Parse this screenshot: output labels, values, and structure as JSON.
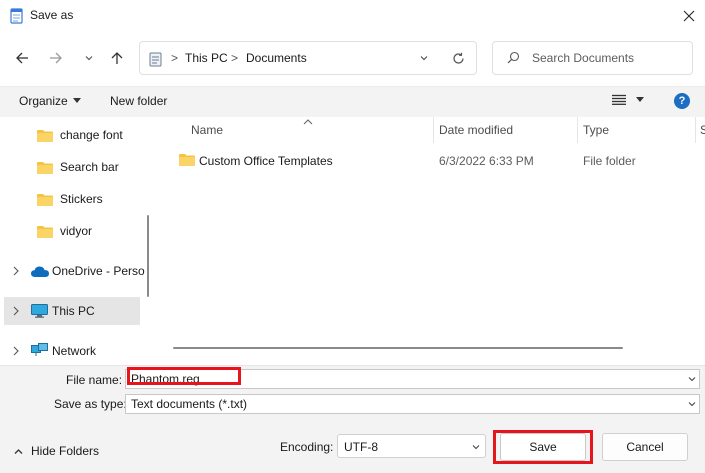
{
  "window": {
    "title": "Save as",
    "icon": "notepad-icon"
  },
  "nav": {
    "back": "arrow-left-icon",
    "forward": "arrow-right-icon",
    "recent": "chevron-down-icon",
    "up": "arrow-up-icon"
  },
  "address": {
    "crumbs": [
      "This PC",
      "Documents"
    ],
    "separator": ">"
  },
  "search": {
    "placeholder": "Search Documents"
  },
  "cmdbar": {
    "organize_label": "Organize",
    "new_folder_label": "New folder",
    "help_label": "?"
  },
  "sidebar": {
    "items": [
      {
        "label": "change font",
        "icon": "folder-icon"
      },
      {
        "label": "Search bar",
        "icon": "folder-icon"
      },
      {
        "label": "Stickers",
        "icon": "folder-icon"
      },
      {
        "label": "vidyor",
        "icon": "folder-icon"
      },
      {
        "label": "OneDrive - Perso",
        "icon": "cloud-icon"
      },
      {
        "label": "This PC",
        "icon": "monitor-icon",
        "selected": true
      },
      {
        "label": "Network",
        "icon": "network-icon"
      }
    ]
  },
  "filelist": {
    "columns": [
      "Name",
      "Date modified",
      "Type",
      "S"
    ],
    "rows": [
      {
        "name": "Custom Office Templates",
        "date": "6/3/2022 6:33 PM",
        "type": "File folder"
      }
    ]
  },
  "form": {
    "file_name_label": "File name:",
    "file_name_value": "Phantom.reg",
    "save_type_label": "Save as type:",
    "save_type_value": "Text documents (*.txt)",
    "hide_folders_label": "Hide Folders",
    "encoding_label": "Encoding:",
    "encoding_value": "UTF-8",
    "save_label": "Save",
    "cancel_label": "Cancel"
  },
  "colors": {
    "highlight": "#e8141c",
    "accent": "#1b6ec2",
    "folder": "#f5c342"
  }
}
